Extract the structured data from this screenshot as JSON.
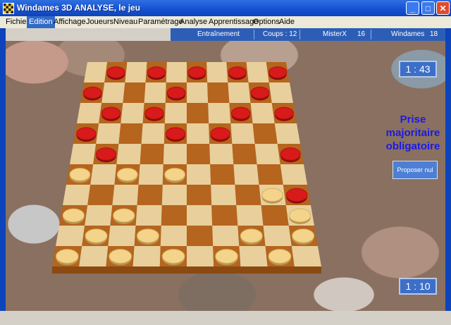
{
  "window": {
    "title": "Windames 3D ANALYSE, le jeu",
    "min_glyph": "_",
    "max_glyph": "□",
    "close_glyph": "✕"
  },
  "menu": [
    "Fichier",
    "Edition",
    "Affichage",
    "Joueurs",
    "Niveau",
    "Paramétrage",
    "Analyse",
    "Apprentissage",
    "Options",
    "Aide"
  ],
  "menu_active": "Edition",
  "status": {
    "mode": "Entraînement",
    "coups": "Coups : 12",
    "player1_name": "MisterX",
    "player1_score": "16",
    "player2_name": "Windames",
    "player2_score": "18"
  },
  "timer_top": "1   : 43",
  "timer_bottom": "1   : 10",
  "message": "Prise majoritaire obligatoire",
  "propose_nul_label": "Proposer nul",
  "colors": {
    "light_square": "#e8cf9c",
    "dark_square": "#b5651d",
    "red_piece": "#d91a1a",
    "white_piece": "#f4d48a"
  },
  "board": {
    "size": 10,
    "red": [
      [
        0,
        1
      ],
      [
        0,
        3
      ],
      [
        0,
        5
      ],
      [
        0,
        7
      ],
      [
        0,
        9
      ],
      [
        1,
        0
      ],
      [
        1,
        4
      ],
      [
        1,
        8
      ],
      [
        2,
        1
      ],
      [
        2,
        3
      ],
      [
        2,
        7
      ],
      [
        2,
        9
      ],
      [
        3,
        0
      ],
      [
        3,
        4
      ],
      [
        3,
        6
      ],
      [
        4,
        1
      ],
      [
        4,
        9
      ]
    ],
    "white": [
      [
        5,
        0
      ],
      [
        5,
        2
      ],
      [
        5,
        4
      ],
      [
        6,
        8
      ],
      [
        7,
        0
      ],
      [
        7,
        2
      ],
      [
        7,
        9
      ],
      [
        8,
        1
      ],
      [
        8,
        3
      ],
      [
        8,
        7
      ],
      [
        8,
        9
      ],
      [
        9,
        0
      ],
      [
        9,
        2
      ],
      [
        9,
        4
      ],
      [
        9,
        6
      ],
      [
        9,
        8
      ]
    ],
    "extra_red": [
      [
        6,
        9
      ]
    ]
  }
}
